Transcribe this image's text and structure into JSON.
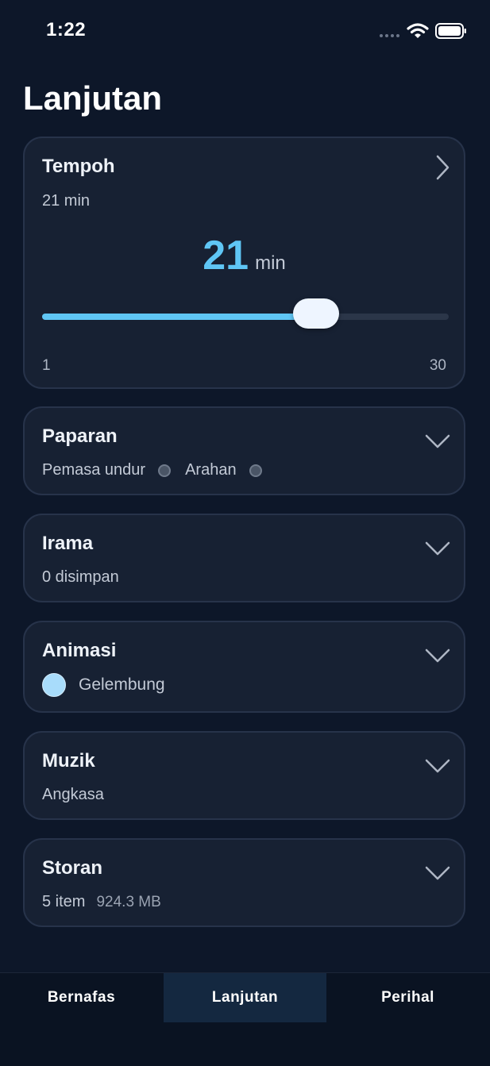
{
  "status_bar": {
    "time": "1:22"
  },
  "page_title": "Lanjutan",
  "tempoh": {
    "title": "Tempoh",
    "subtitle": "21 min",
    "value": "21",
    "unit": "min",
    "slider_value": 21,
    "min_label": "1",
    "max_label": "30",
    "min": 1,
    "max": 30
  },
  "paparan": {
    "title": "Paparan",
    "options": [
      "Pemasa undur",
      "Arahan"
    ]
  },
  "irama": {
    "title": "Irama",
    "subtitle": "0 disimpan"
  },
  "animasi": {
    "title": "Animasi",
    "selected": "Gelembung"
  },
  "muzik": {
    "title": "Muzik",
    "subtitle": "Angkasa"
  },
  "storan": {
    "title": "Storan",
    "items": "5 item",
    "size": "924.3 MB"
  },
  "tabs": [
    {
      "label": "Bernafas",
      "active": false
    },
    {
      "label": "Lanjutan",
      "active": true
    },
    {
      "label": "Perihal",
      "active": false
    }
  ],
  "colors": {
    "background": "#0d1729",
    "card": "#172133",
    "accent": "#5fc6f5",
    "thumb": "#eef5ff",
    "bubble": "#a8dcfb"
  }
}
